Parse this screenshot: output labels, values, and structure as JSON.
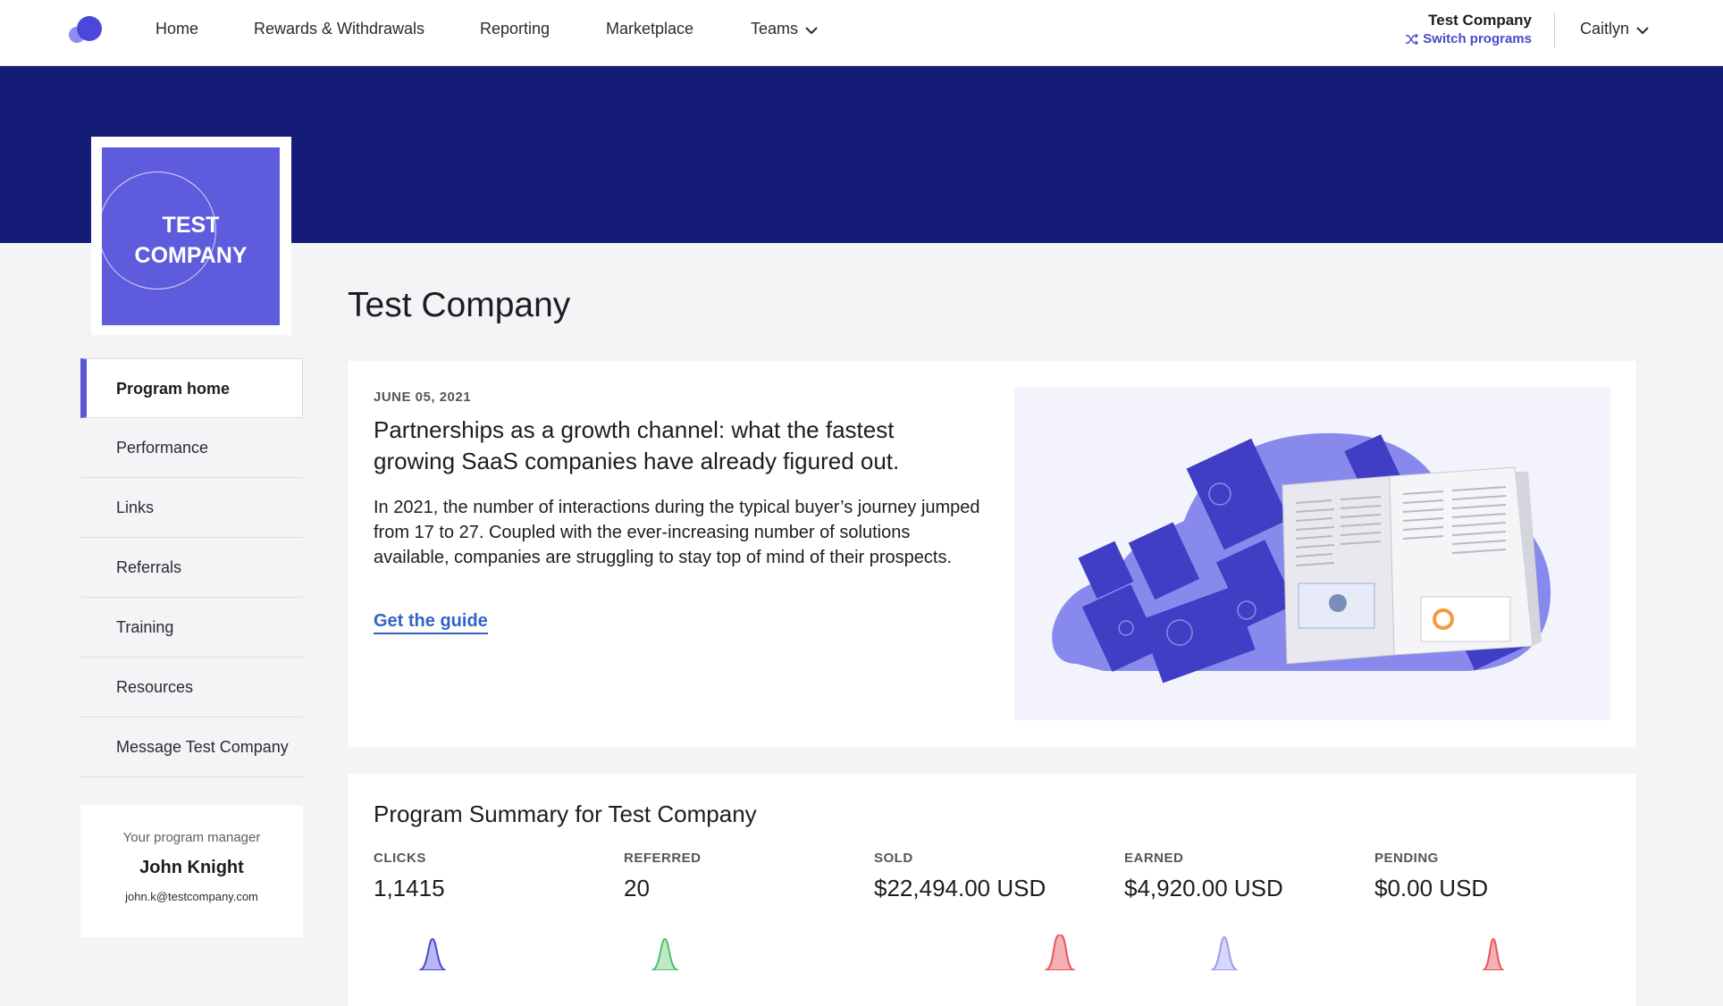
{
  "nav": {
    "items": [
      {
        "label": "Home"
      },
      {
        "label": "Rewards & Withdrawals"
      },
      {
        "label": "Reporting"
      },
      {
        "label": "Marketplace"
      },
      {
        "label": "Teams"
      }
    ],
    "company": "Test Company",
    "switch_label": "Switch programs",
    "user": "Caitlyn"
  },
  "logo": {
    "line1": "TEST",
    "line2": "COMPANY"
  },
  "page_title": "Test Company",
  "sidebar": {
    "items": [
      {
        "label": "Program home",
        "active": true
      },
      {
        "label": "Performance"
      },
      {
        "label": "Links"
      },
      {
        "label": "Referrals"
      },
      {
        "label": "Training"
      },
      {
        "label": "Resources"
      },
      {
        "label": "Message Test Company"
      }
    ]
  },
  "manager": {
    "label": "Your program manager",
    "name": "John Knight",
    "email": "john.k@testcompany.com"
  },
  "article": {
    "date": "JUNE 05, 2021",
    "title": "Partnerships as a growth channel: what the fastest growing SaaS companies have already figured out.",
    "body": "In 2021, the number of interactions during the typical buyer’s journey jumped from 17 to 27. Coupled with the ever-increasing number of solutions available, companies are struggling to stay top of mind of their prospects.",
    "link": "Get the guide"
  },
  "summary": {
    "title": "Program Summary for Test Company",
    "stats": [
      {
        "label": "CLICKS",
        "value": "1,1415",
        "color": "#5a5ad8"
      },
      {
        "label": "REFERRED",
        "value": "20",
        "color": "#4fc06a"
      },
      {
        "label": "SOLD",
        "value": "$22,494.00 USD",
        "color": "#e8555a"
      },
      {
        "label": "EARNED",
        "value": "$4,920.00 USD",
        "color": "#9a9cf0"
      },
      {
        "label": "PENDING",
        "value": "$0.00 USD",
        "color": "#e8555a"
      }
    ]
  },
  "colors": {
    "banner": "#141c78",
    "accent": "#5a58d6",
    "link": "#3263c8",
    "logo_bg": "#5e5cdd"
  }
}
